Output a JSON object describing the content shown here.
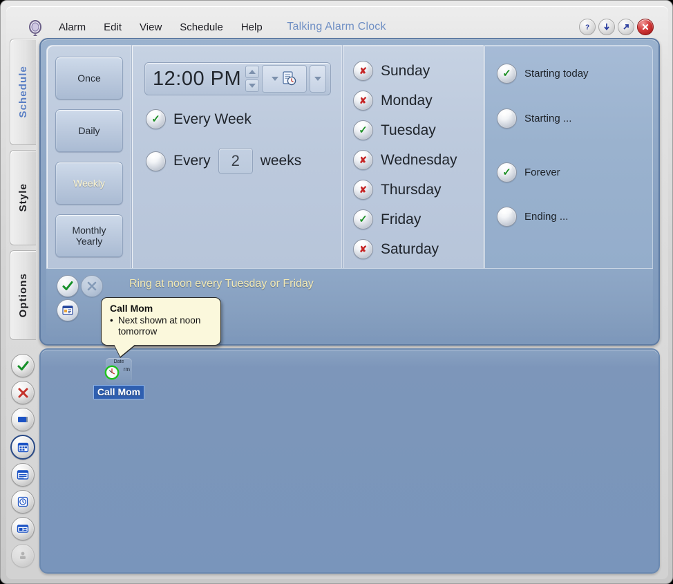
{
  "window": {
    "title": "Talking Alarm Clock",
    "logo_icon": "clock-logo-icon",
    "buttons": [
      {
        "name": "help-button",
        "icon": "question-mark-icon",
        "label": "?"
      },
      {
        "name": "minimize-button",
        "icon": "arrow-down-icon",
        "label": "↓"
      },
      {
        "name": "restore-button",
        "icon": "arrow-up-right-icon",
        "label": "↗"
      },
      {
        "name": "close-button",
        "icon": "close-x-icon",
        "label": "✕"
      }
    ]
  },
  "menu": {
    "items": [
      "Alarm",
      "Edit",
      "View",
      "Schedule",
      "Help"
    ]
  },
  "side_tabs": [
    {
      "label": "Schedule",
      "active": true
    },
    {
      "label": "Style",
      "active": false
    },
    {
      "label": "Options",
      "active": false
    }
  ],
  "frequency": {
    "buttons": [
      {
        "label": "Once",
        "selected": false
      },
      {
        "label": "Daily",
        "selected": false
      },
      {
        "label": "Weekly",
        "selected": true
      },
      {
        "label": "Monthly\nYearly",
        "line1": "Monthly",
        "line2": "Yearly",
        "selected": false
      }
    ]
  },
  "time": {
    "value": "12:00 PM",
    "spinner_up_icon": "spin-up-icon",
    "spinner_down_icon": "spin-down-icon",
    "preset_icon": "document-clock-icon",
    "preset_dropdown_icon": "chevron-down-icon",
    "extra_dropdown_icon": "chevron-down-icon"
  },
  "recurrence": {
    "every_week": {
      "label": "Every Week",
      "checked": true
    },
    "every_n_weeks": {
      "prefix": "Every",
      "value": "2",
      "suffix": "weeks",
      "checked": false
    }
  },
  "days": [
    {
      "label": "Sunday",
      "checked": false
    },
    {
      "label": "Monday",
      "checked": false
    },
    {
      "label": "Tuesday",
      "checked": true
    },
    {
      "label": "Wednesday",
      "checked": false
    },
    {
      "label": "Thursday",
      "checked": false
    },
    {
      "label": "Friday",
      "checked": true
    },
    {
      "label": "Saturday",
      "checked": false
    }
  ],
  "range": [
    {
      "label": "Starting today",
      "checked": true
    },
    {
      "label": "Starting ...",
      "checked": false
    },
    {
      "label": "Forever",
      "checked": true
    },
    {
      "label": "Ending ...",
      "checked": false
    }
  ],
  "status_strip": {
    "summary": "Ring at noon every Tuesday or Friday",
    "buttons": [
      {
        "name": "enable-alarm-button",
        "icon": "green-check-icon",
        "dim": false
      },
      {
        "name": "tools-button",
        "icon": "hammer-tool-icon",
        "dim": true
      },
      {
        "name": "edit-schedule-button",
        "icon": "calendar-edit-icon",
        "dim": false
      }
    ]
  },
  "tooltip": {
    "title": "Call Mom",
    "bullet": "Next shown at noon tomorrow"
  },
  "icon_rail": [
    {
      "name": "rail-accept-icon",
      "icon": "green-check-icon",
      "selected": false,
      "dim": false
    },
    {
      "name": "rail-delete-icon",
      "icon": "red-x-icon",
      "selected": false,
      "dim": false
    },
    {
      "name": "rail-display-icon",
      "icon": "monitor-icon",
      "selected": false,
      "dim": false
    },
    {
      "name": "rail-grid-icon",
      "icon": "grid-window-icon",
      "selected": true,
      "dim": false
    },
    {
      "name": "rail-list-icon",
      "icon": "list-window-icon",
      "selected": false,
      "dim": false
    },
    {
      "name": "rail-alarm-icon",
      "icon": "alarm-clock-icon",
      "selected": false,
      "dim": false
    },
    {
      "name": "rail-panel-icon",
      "icon": "panel-window-icon",
      "selected": false,
      "dim": false
    },
    {
      "name": "rail-group-icon",
      "icon": "group-people-icon",
      "selected": false,
      "dim": true
    }
  ],
  "desktop": {
    "item": {
      "label": "Call Mom",
      "tile_word1": "Date",
      "tile_word2": "rm",
      "icon": "date-alarm-clock-icon"
    }
  },
  "colors": {
    "accent_title": "#6f8fc4",
    "panel_outer": "#89a2c2",
    "panel_inner": "#bdcadd",
    "panel_range": "#9ab2ce",
    "desktop_bg": "#7995bb",
    "summary_text": "#f2e9b4",
    "check_green": "#1d9025",
    "cross_red": "#c62525",
    "selection_blue": "#2f5fb0",
    "close_red": "#d33a3a"
  }
}
